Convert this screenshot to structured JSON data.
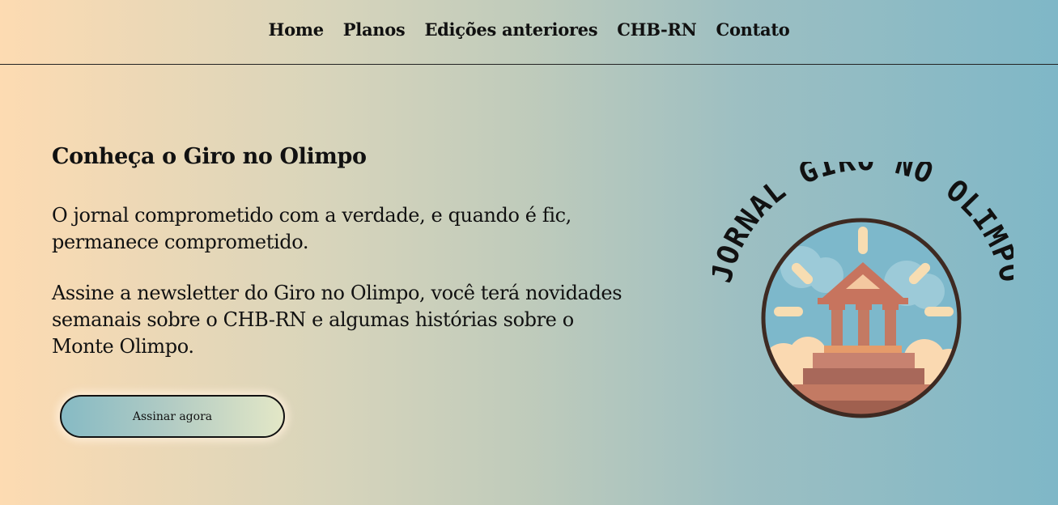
{
  "nav": {
    "items": [
      {
        "label": "Home"
      },
      {
        "label": "Planos"
      },
      {
        "label": "Edições anteriores"
      },
      {
        "label": "CHB-RN"
      },
      {
        "label": "Contato"
      }
    ]
  },
  "hero": {
    "title": "Conheça o Giro no Olimpo",
    "paragraph1": "O jornal comprometido com a verdade, e quando é fic, permanece comprometido.",
    "paragraph2": "Assine a newsletter do Giro no Olimpo, você terá novidades semanais sobre o CHB-RN e algumas histórias sobre o Monte Olimpo.",
    "cta_label": "Assinar agora"
  },
  "logo": {
    "text": "JORNAL GIRO NO OLIMPO",
    "icon": "greek-temple-icon"
  },
  "colors": {
    "gradient_left": "#fddbb2",
    "gradient_right": "#7fb7c7",
    "text": "#111111"
  }
}
